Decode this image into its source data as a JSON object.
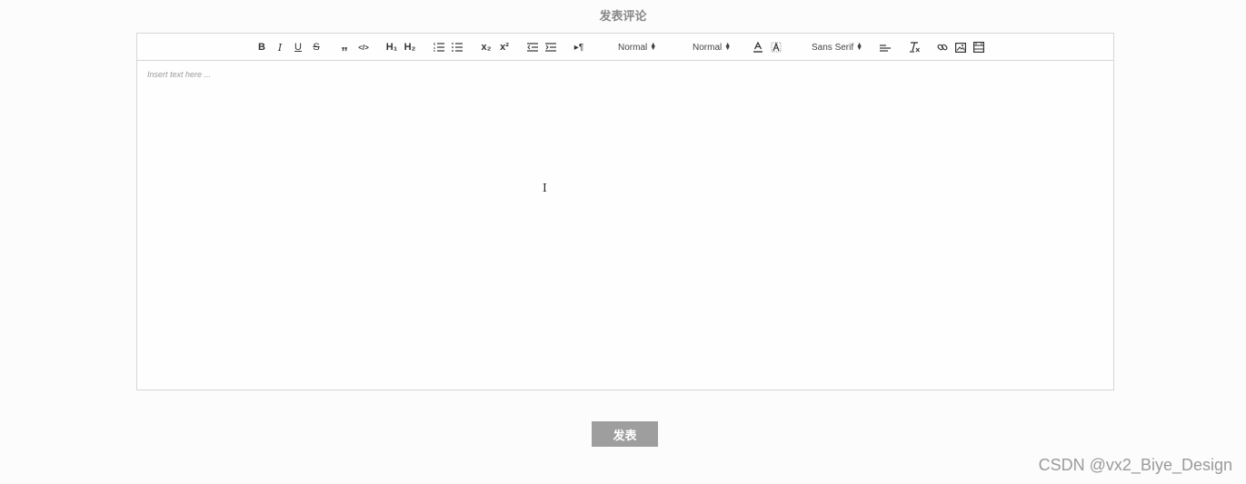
{
  "section_title": "发表评论",
  "toolbar": {
    "bold_label": "B",
    "italic_label": "I",
    "underline_label": "U",
    "strike_label": "S",
    "blockquote_label": "”",
    "code_label": "</>",
    "h1_label": "H₁",
    "h2_label": "H₂",
    "subscript_label": "x₂",
    "superscript_label": "x²",
    "direction_label": "▸¶",
    "size_picker_value": "Normal",
    "header_picker_value": "Normal",
    "font_picker_value": "Sans Serif",
    "icons": [
      "bold-icon",
      "italic-icon",
      "underline-icon",
      "strike-icon",
      "blockquote-icon",
      "code-block-icon",
      "h1-icon",
      "h2-icon",
      "ordered-list-icon",
      "bullet-list-icon",
      "subscript-icon",
      "superscript-icon",
      "outdent-icon",
      "indent-icon",
      "text-direction-icon",
      "font-color-icon",
      "background-color-icon",
      "align-icon",
      "clean-icon",
      "link-icon",
      "image-icon",
      "video-icon"
    ]
  },
  "editor": {
    "placeholder": "Insert text here ..."
  },
  "submit_label": "发表",
  "watermark": "CSDN @vx2_Biye_Design",
  "colors": {
    "button_bg": "#9e9e9e",
    "border": "#d6d6d6",
    "title": "#888888"
  }
}
